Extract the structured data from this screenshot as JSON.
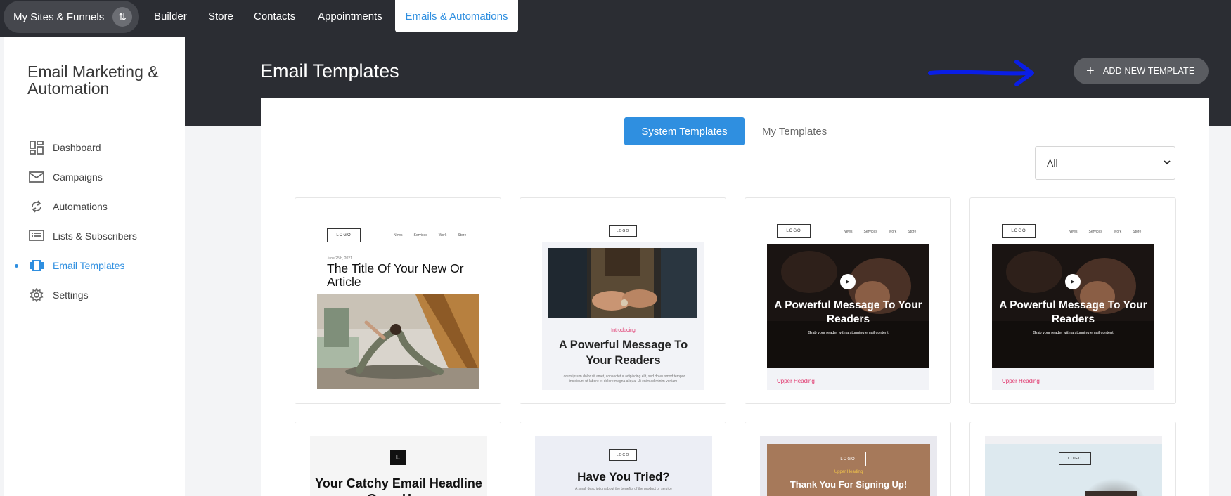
{
  "topnav": {
    "sites_label": "My Sites & Funnels",
    "items": [
      {
        "label": "Builder"
      },
      {
        "label": "Store"
      },
      {
        "label": "Contacts"
      },
      {
        "label": "Appointments"
      },
      {
        "label": "Emails & Automations"
      }
    ],
    "active_item": "Emails & Automations"
  },
  "sidebar": {
    "title": "Email Marketing & Automation",
    "items": [
      {
        "label": "Dashboard",
        "icon": "dashboard-icon"
      },
      {
        "label": "Campaigns",
        "icon": "mail-icon"
      },
      {
        "label": "Automations",
        "icon": "refresh-icon"
      },
      {
        "label": "Lists & Subscribers",
        "icon": "list-icon"
      },
      {
        "label": "Email Templates",
        "icon": "carousel-icon",
        "active": true
      },
      {
        "label": "Settings",
        "icon": "gear-icon"
      }
    ]
  },
  "header": {
    "title": "Email Templates",
    "add_button": "ADD NEW TEMPLATE"
  },
  "tabs": {
    "system": "System Templates",
    "mine": "My Templates",
    "active": "System Templates"
  },
  "filter": {
    "selected": "All"
  },
  "templates": [
    {
      "logo": "LOGO",
      "nav": [
        "News",
        "Services",
        "Work",
        "Store"
      ],
      "date": "June 25th, 2021",
      "title": "The Title Of Your New Or Article"
    },
    {
      "logo": "LOGO",
      "intro": "Introducing",
      "headline": "A Powerful Message To Your Readers",
      "body": "Lorem ipsum dolor sit amet, consectetur adipiscing elit, sed do eiusmod tempor incididunt ut labore et dolore magna aliqua. Ut enim ad minim veniam"
    },
    {
      "logo": "LOGO",
      "nav": [
        "News",
        "Services",
        "Work",
        "Store"
      ],
      "headline": "A Powerful Message To Your Readers",
      "sub": "Grab your reader with a stunning email content",
      "upper_heading": "Upper Heading"
    },
    {
      "logo": "LOGO",
      "nav": [
        "News",
        "Services",
        "Work",
        "Store"
      ],
      "headline": "A Powerful Message To Your Readers",
      "sub": "Grab your reader with a stunning email content",
      "upper_heading": "Upper Heading"
    },
    {
      "logo": "L",
      "headline": "Your Catchy Email Headline Goes Here"
    },
    {
      "logo": "LOGO",
      "headline": "Have You Tried?",
      "sub": "A small description about the benefits of the product or service"
    },
    {
      "logo": "LOGO",
      "upper": "Upper Heading",
      "headline": "Thank You For Signing Up!"
    },
    {
      "logo": "LOGO"
    }
  ],
  "colors": {
    "accent": "#2f8fe0",
    "nav_bg": "#2b2d33",
    "pink": "#e0336b",
    "annotation_arrow": "#0a1ee6"
  }
}
